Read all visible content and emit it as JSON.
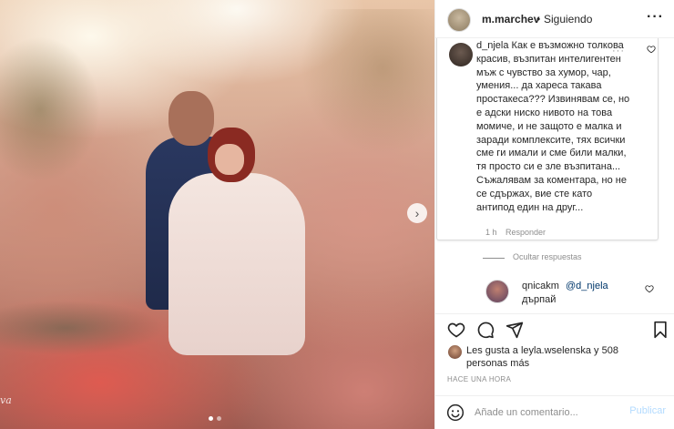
{
  "post": {
    "photo": {
      "watermark": "va",
      "carousel_dots": 2,
      "active_dot": 0
    }
  },
  "header": {
    "username": "m.marchev",
    "separator": "•",
    "follow_status": "Siguiendo",
    "more_icon": "more-horizontal-icon"
  },
  "comment": {
    "username": "d_njela",
    "text": "Как е възможно толкова красив, възпитан интелигентен мъж с чувство за хумор, чар, умения... да хареса такава простакеса??? Извинявам се, но е адски ниско нивото на това момиче, и не защото е малка и заради комплексите, тях всички сме ги имали и сме били малки, тя просто си е зле възпитана... Съжалявам за коментара, но не се сдържах, вие сте като антипод един на друг...",
    "time": "1 h",
    "reply_label": "Responder",
    "options_icon": "ellipsis-icon",
    "like_icon": "heart-icon"
  },
  "replies_toggle": "Ocultar respuestas",
  "reply": {
    "username": "qnicakm",
    "mention": "@d_njela",
    "text": "дърпай",
    "like_icon": "heart-icon"
  },
  "actions": {
    "like_icon": "heart-icon",
    "comment_icon": "comment-icon",
    "share_icon": "share-icon",
    "save_icon": "bookmark-icon"
  },
  "likes": {
    "text_prefix": "Les gusta a",
    "user": "leyla.wselenska",
    "text_suffix": "y 508 personas más"
  },
  "time_ago": "HACE UNA HORA",
  "add_comment": {
    "placeholder": "Añade un comentario...",
    "value": "",
    "post_label": "Publicar",
    "emoji_icon": "smiley-icon"
  },
  "colors": {
    "text": "#262626",
    "muted": "#8e8e8e",
    "link": "#00376b",
    "post_disabled": "#b3dbff",
    "border": "#dbdbdb"
  }
}
